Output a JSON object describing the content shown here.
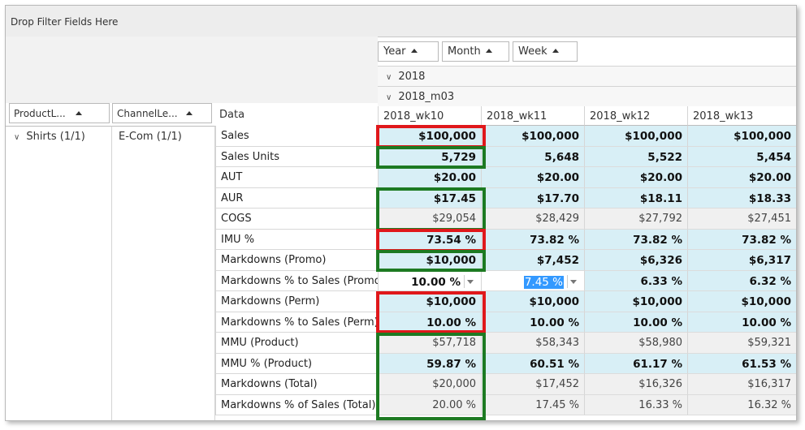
{
  "filter_area": {
    "label": "Drop Filter Fields Here"
  },
  "column_fields": [
    {
      "label": "Year"
    },
    {
      "label": "Month"
    },
    {
      "label": "Week"
    }
  ],
  "row_fields": [
    {
      "label": "ProductL..."
    },
    {
      "label": "ChannelLe..."
    }
  ],
  "data_header": "Data",
  "year": "2018",
  "month": "2018_m03",
  "weeks": [
    "2018_wk10",
    "2018_wk11",
    "2018_wk12",
    "2018_wk13"
  ],
  "product": "Shirts (1/1)",
  "channel": "E-Com (1/1)",
  "measures": [
    "Sales",
    "Sales Units",
    "AUT",
    "AUR",
    "COGS",
    "IMU %",
    "Markdowns (Promo)",
    "Markdowns % to Sales (Promo)",
    "Markdowns (Perm)",
    "Markdowns % to Sales (Perm)",
    "MMU (Product)",
    "MMU % (Product)",
    "Markdowns (Total)",
    "Markdowns % of Sales (Total)"
  ],
  "rows": [
    [
      "$100,000",
      "$100,000",
      "$100,000",
      "$100,000"
    ],
    [
      "5,729",
      "5,648",
      "5,522",
      "5,454"
    ],
    [
      "$20.00",
      "$20.00",
      "$20.00",
      "$20.00"
    ],
    [
      "$17.45",
      "$17.70",
      "$18.11",
      "$18.33"
    ],
    [
      "$29,054",
      "$28,429",
      "$27,792",
      "$27,451"
    ],
    [
      "73.54 %",
      "73.82 %",
      "73.82 %",
      "73.82 %"
    ],
    [
      "$10,000",
      "$7,452",
      "$6,326",
      "$6,317"
    ],
    [
      "10.00 %",
      "7.45 %",
      "6.33 %",
      "6.32 %"
    ],
    [
      "$10,000",
      "$10,000",
      "$10,000",
      "$10,000"
    ],
    [
      "10.00 %",
      "10.00 %",
      "10.00 %",
      "10.00 %"
    ],
    [
      "$57,718",
      "$58,343",
      "$58,980",
      "$59,321"
    ],
    [
      "59.87 %",
      "60.51 %",
      "61.17 %",
      "61.53 %"
    ],
    [
      "$20,000",
      "$17,452",
      "$16,326",
      "$16,317"
    ],
    [
      "20.00 %",
      "17.45 %",
      "16.33 %",
      "16.32 %"
    ]
  ],
  "row_styles": [
    "bold",
    "bold",
    "bold",
    "bold",
    "norm",
    "bold",
    "bold",
    "bold",
    "bold",
    "bold",
    "norm",
    "bold",
    "norm",
    "norm"
  ],
  "highlight_colors": {
    "red": "#e0181b",
    "green": "#1d7a22",
    "cell_bg": "#d8eff6",
    "selection": "#3399ff"
  },
  "icons": [
    "sort-ascending-icon",
    "expand-chevron-icon",
    "dropdown-arrow-icon"
  ]
}
